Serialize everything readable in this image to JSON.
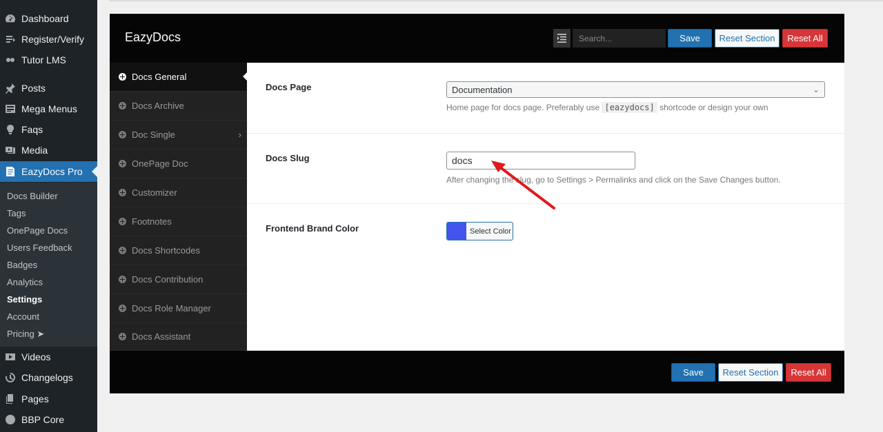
{
  "wp_menu": {
    "items": [
      {
        "label": "Dashboard",
        "icon": "dashboard-icon"
      },
      {
        "label": "Register/Verify",
        "icon": "register-icon"
      },
      {
        "label": "Tutor LMS",
        "icon": "tutor-icon"
      },
      {
        "label": "Posts",
        "icon": "pin-icon"
      },
      {
        "label": "Mega Menus",
        "icon": "menu-icon"
      },
      {
        "label": "Faqs",
        "icon": "lightbulb-icon"
      },
      {
        "label": "Media",
        "icon": "media-icon"
      },
      {
        "label": "EazyDocs Pro",
        "icon": "docs-icon"
      }
    ],
    "submenu": [
      "Docs Builder",
      "Tags",
      "OnePage Docs",
      "Users Feedback",
      "Badges",
      "Analytics",
      "Settings",
      "Account",
      "Pricing ➤"
    ],
    "lower_items": [
      {
        "label": "Videos",
        "icon": "video-icon"
      },
      {
        "label": "Changelogs",
        "icon": "history-icon"
      },
      {
        "label": "Pages",
        "icon": "pages-icon"
      },
      {
        "label": "BBP Core",
        "icon": "bbp-icon"
      }
    ]
  },
  "panel": {
    "brand": "EazyDocs",
    "search_placeholder": "Search...",
    "save_label": "Save",
    "reset_section_label": "Reset Section",
    "reset_all_label": "Reset All"
  },
  "nav": [
    "Docs General",
    "Docs Archive",
    "Doc Single",
    "OnePage Doc",
    "Customizer",
    "Footnotes",
    "Docs Shortcodes",
    "Docs Contribution",
    "Docs Role Manager",
    "Docs Assistant"
  ],
  "fields": {
    "docs_page": {
      "label": "Docs Page",
      "value": "Documentation",
      "desc_before": "Home page for docs page. Preferably use",
      "code": "[eazydocs]",
      "desc_after": "shortcode or design your own"
    },
    "docs_slug": {
      "label": "Docs Slug",
      "value": "docs",
      "desc": "After changing the slug, go to Settings > Permalinks and click on the Save Changes button."
    },
    "brand_color": {
      "label": "Frontend Brand Color",
      "button_label": "Select Color",
      "color": "#4353ed"
    }
  },
  "colors": {
    "wp_accent": "#2271b1",
    "danger": "#d63638",
    "annotation_arrow": "#e0191b"
  }
}
